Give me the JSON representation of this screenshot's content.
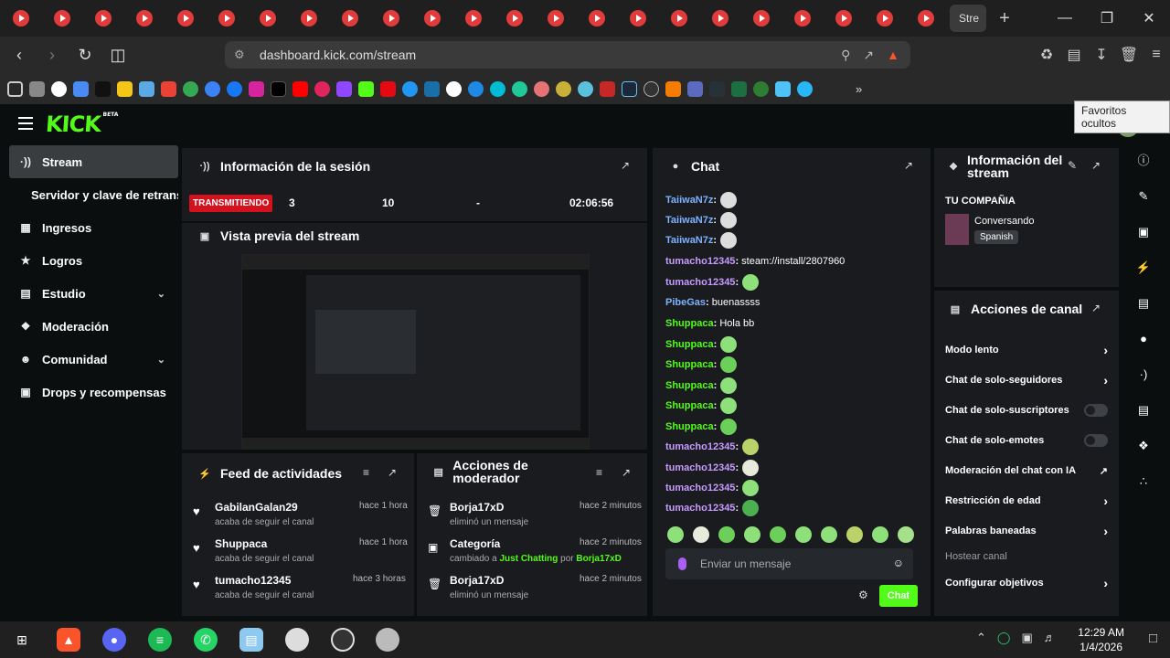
{
  "browser": {
    "active_tab_title": "Stre",
    "url": "dashboard.kick.com/stream",
    "tooltip": "Favoritos ocultos",
    "extension_badge": "5"
  },
  "brand": {
    "logo": "KICK",
    "beta": "BETA",
    "accent": "#53fc18"
  },
  "sidebar": {
    "items": [
      {
        "label": "Stream",
        "icon": "broadcast-icon"
      },
      {
        "label": "Servidor y clave de retransmisión",
        "icon": ""
      },
      {
        "label": "Ingresos",
        "icon": "chart-icon"
      },
      {
        "label": "Logros",
        "icon": "trophy-icon"
      },
      {
        "label": "Estudio",
        "icon": "studio-icon"
      },
      {
        "label": "Moderación",
        "icon": "wrench-icon"
      },
      {
        "label": "Comunidad",
        "icon": "community-icon"
      },
      {
        "label": "Drops y recompensas",
        "icon": "gift-icon"
      }
    ]
  },
  "session": {
    "title": "Información de la sesión",
    "status": "TRANSMITIENDO",
    "viewers": "3",
    "followers": "10",
    "subs": "-",
    "duration": "02:06:56"
  },
  "preview": {
    "title": "Vista previa del stream"
  },
  "feed": {
    "title": "Feed de actividades",
    "items": [
      {
        "name": "GabilanGalan29",
        "action": "acaba de seguir el canal",
        "time": "hace 1 hora"
      },
      {
        "name": "Shuppaca",
        "action": "acaba de seguir el canal",
        "time": "hace 1 hora"
      },
      {
        "name": "tumacho12345",
        "action": "acaba de seguir el canal",
        "time": "hace 3 horas"
      }
    ]
  },
  "mod_actions": {
    "title": "Acciones de moderador",
    "items": [
      {
        "name": "Borja17xD",
        "action": "eliminó un mensaje",
        "time": "hace 2 minutos"
      },
      {
        "name": "Categoría",
        "action_prefix": "cambiado a",
        "action_value": "Just Chatting",
        "action_mid": "por",
        "action_user": "Borja17xD",
        "time": "hace 2 minutos"
      },
      {
        "name": "Borja17xD",
        "action": "eliminó un mensaje",
        "time": "hace 2 minutos"
      }
    ]
  },
  "chat": {
    "title": "Chat",
    "messages": [
      {
        "user": "TaiiwaN7z",
        "text": "",
        "color": "#7fb2ff"
      },
      {
        "user": "TaiiwaN7z",
        "text": "",
        "color": "#7fb2ff"
      },
      {
        "user": "TaiiwaN7z",
        "text": "",
        "color": "#7fb2ff"
      },
      {
        "user": "tumacho12345",
        "text": "steam://install/2807960",
        "color": "#c79bff"
      },
      {
        "user": "tumacho12345",
        "text": "",
        "color": "#c79bff"
      },
      {
        "user": "PibeGas",
        "text": "buenassss",
        "color": "#7fb2ff"
      },
      {
        "user": "Shuppaca",
        "text": "Hola bb",
        "color": "#53fc18"
      },
      {
        "user": "Shuppaca",
        "text": "",
        "color": "#53fc18"
      },
      {
        "user": "Shuppaca",
        "text": "",
        "color": "#53fc18"
      },
      {
        "user": "Shuppaca",
        "text": "",
        "color": "#53fc18"
      },
      {
        "user": "Shuppaca",
        "text": "",
        "color": "#53fc18"
      },
      {
        "user": "Shuppaca",
        "text": "",
        "color": "#53fc18"
      },
      {
        "user": "tumacho12345",
        "text": "",
        "color": "#c79bff"
      },
      {
        "user": "tumacho12345",
        "text": "",
        "color": "#c79bff"
      },
      {
        "user": "tumacho12345",
        "text": "",
        "color": "#c79bff"
      },
      {
        "user": "tumacho12345",
        "text": "",
        "color": "#c79bff"
      }
    ],
    "placeholder": "Enviar un mensaje",
    "send_label": "Chat"
  },
  "stream_info": {
    "title": "Información del stream",
    "company": "TU COMPAÑIA",
    "category": "Conversando",
    "language": "Spanish"
  },
  "channel_actions": {
    "title": "Acciones de canal",
    "items": [
      {
        "label": "Modo lento",
        "control": "arrow"
      },
      {
        "label": "Chat de solo-seguidores",
        "control": "arrow"
      },
      {
        "label": "Chat de solo-suscriptores",
        "control": "toggle"
      },
      {
        "label": "Chat de solo-emotes",
        "control": "toggle"
      },
      {
        "label": "Moderación del chat con IA",
        "control": "external"
      },
      {
        "label": "Restricción de edad",
        "control": "arrow"
      },
      {
        "label": "Palabras baneadas",
        "control": "arrow"
      },
      {
        "label": "Hostear canal",
        "control": "none"
      },
      {
        "label": "Configurar objetivos",
        "control": "arrow"
      }
    ]
  },
  "taskbar": {
    "time": "12:29 AM",
    "date": "1/4/2026"
  }
}
